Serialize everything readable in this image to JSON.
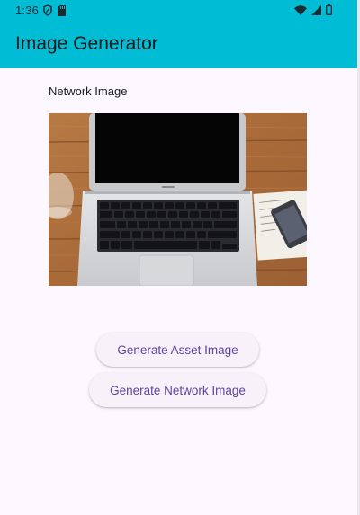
{
  "status_bar": {
    "time": "1:36",
    "left_icons": [
      "shield-icon",
      "sd-card-icon"
    ],
    "right_icons": [
      "wifi-icon",
      "signal-icon",
      "battery-icon"
    ]
  },
  "app_bar": {
    "title": "Image Generator",
    "color": "#00bcd4"
  },
  "content": {
    "image_label": "Network Image",
    "image_description": "laptop-on-wooden-desk"
  },
  "buttons": {
    "asset": "Generate Asset Image",
    "network": "Generate Network Image"
  },
  "colors": {
    "background": "#fdf7ff",
    "button_text": "#5a45a0"
  }
}
